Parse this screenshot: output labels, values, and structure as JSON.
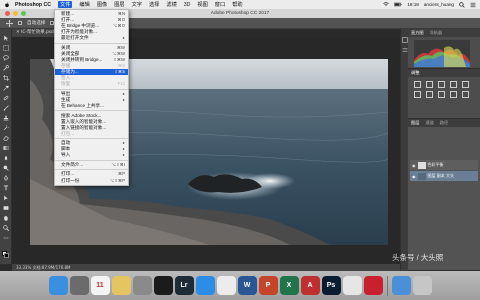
{
  "menubar": {
    "app_name": "Photoshop CC",
    "items": [
      "文件",
      "编辑",
      "图像",
      "图层",
      "文字",
      "选择",
      "滤镜",
      "3D",
      "视图",
      "窗口",
      "帮助"
    ],
    "time": "18:18",
    "user": "ancient_huang"
  },
  "window": {
    "title": "Adobe Photoshop CC 2017"
  },
  "options_bar": {
    "auto_select": "自动选择",
    "show_transform": "显示变换控件"
  },
  "document_tab": "IC-帮忙效果.psd",
  "status": {
    "zoom": "33.33%",
    "doc_size": "文档:87.9M/176.8M"
  },
  "file_menu": {
    "items": [
      {
        "label": "新建...",
        "shortcut": "⌘N",
        "state": "normal"
      },
      {
        "label": "打开...",
        "shortcut": "⌘O",
        "state": "normal"
      },
      {
        "label": "在 Bridge 中浏览...",
        "shortcut": "⌥⌘O",
        "state": "normal"
      },
      {
        "label": "打开为智能对象...",
        "shortcut": "",
        "state": "normal"
      },
      {
        "label": "最近打开文件",
        "shortcut": "▸",
        "state": "normal"
      },
      {
        "sep": true
      },
      {
        "label": "关闭",
        "shortcut": "⌘W",
        "state": "normal"
      },
      {
        "label": "关闭全部",
        "shortcut": "⌥⌘W",
        "state": "normal"
      },
      {
        "label": "关闭并转到 Bridge...",
        "shortcut": "⇧⌘W",
        "state": "normal"
      },
      {
        "label": "存储",
        "shortcut": "⌘S",
        "state": "disabled"
      },
      {
        "label": "存储为...",
        "shortcut": "⇧⌘S",
        "state": "highlight"
      },
      {
        "label": "签入...",
        "shortcut": "",
        "state": "disabled"
      },
      {
        "label": "恢复",
        "shortcut": "F12",
        "state": "disabled"
      },
      {
        "sep": true
      },
      {
        "label": "导出",
        "shortcut": "▸",
        "state": "normal"
      },
      {
        "label": "生成",
        "shortcut": "▸",
        "state": "normal"
      },
      {
        "label": "在 Behance 上共享...",
        "shortcut": "",
        "state": "normal"
      },
      {
        "sep": true
      },
      {
        "label": "搜索 Adobe Stock...",
        "shortcut": "",
        "state": "normal"
      },
      {
        "label": "置入嵌入的智能对象...",
        "shortcut": "",
        "state": "normal"
      },
      {
        "label": "置入链接的智能对象...",
        "shortcut": "",
        "state": "normal"
      },
      {
        "label": "打包...",
        "shortcut": "",
        "state": "disabled"
      },
      {
        "sep": true
      },
      {
        "label": "自动",
        "shortcut": "▸",
        "state": "normal"
      },
      {
        "label": "脚本",
        "shortcut": "▸",
        "state": "normal"
      },
      {
        "label": "导入",
        "shortcut": "▸",
        "state": "normal"
      },
      {
        "sep": true
      },
      {
        "label": "文件简介...",
        "shortcut": "⌥⇧⌘I",
        "state": "normal"
      },
      {
        "sep": true
      },
      {
        "label": "打印...",
        "shortcut": "⌘P",
        "state": "normal"
      },
      {
        "label": "打印一份",
        "shortcut": "⌥⇧⌘P",
        "state": "normal"
      }
    ]
  },
  "panels": {
    "histogram": {
      "tab1": "直方图",
      "tab2": "导航器"
    },
    "adjustments": {
      "title": "调整"
    },
    "layers": {
      "tab1": "图层",
      "tab2": "通道",
      "tab3": "路径",
      "layer1": "色彩平衡",
      "layer2": "图层 副本 大头"
    }
  },
  "dock": {
    "apps": [
      {
        "icon": "finder-icon",
        "color": "#3b8fe0",
        "label": ""
      },
      {
        "icon": "launchpad-icon",
        "color": "#6b6b6b",
        "label": ""
      },
      {
        "icon": "calendar-icon",
        "color": "#f4f4f4",
        "label": "11"
      },
      {
        "icon": "notes-icon",
        "color": "#e5c560",
        "label": ""
      },
      {
        "icon": "preferences-icon",
        "color": "#8a8a8a",
        "label": ""
      },
      {
        "icon": "qq-icon",
        "color": "#1b1b1b",
        "label": ""
      },
      {
        "icon": "lightroom-icon",
        "color": "#1e2b38",
        "label": "Lr"
      },
      {
        "icon": "appstore-icon",
        "color": "#2b8de6",
        "label": ""
      },
      {
        "icon": "chrome-icon",
        "color": "#ececec",
        "label": ""
      },
      {
        "icon": "word-icon",
        "color": "#2a5696",
        "label": "W"
      },
      {
        "icon": "ppt-icon",
        "color": "#c5442a",
        "label": "P"
      },
      {
        "icon": "excel-icon",
        "color": "#20744a",
        "label": "X"
      },
      {
        "icon": "autocad-icon",
        "color": "#c02f2f",
        "label": "A"
      },
      {
        "icon": "photoshop-icon",
        "color": "#0a1c30",
        "label": "Ps"
      },
      {
        "icon": "mail-icon",
        "color": "#e6e6e6",
        "label": ""
      },
      {
        "icon": "netease-icon",
        "color": "#c8202c",
        "label": ""
      },
      {
        "icon": "downloads-icon",
        "color": "#4a8fd8",
        "label": ""
      },
      {
        "icon": "trash-icon",
        "color": "#c6c6c6",
        "label": ""
      }
    ]
  },
  "watermark": "头条号 / 大头照"
}
